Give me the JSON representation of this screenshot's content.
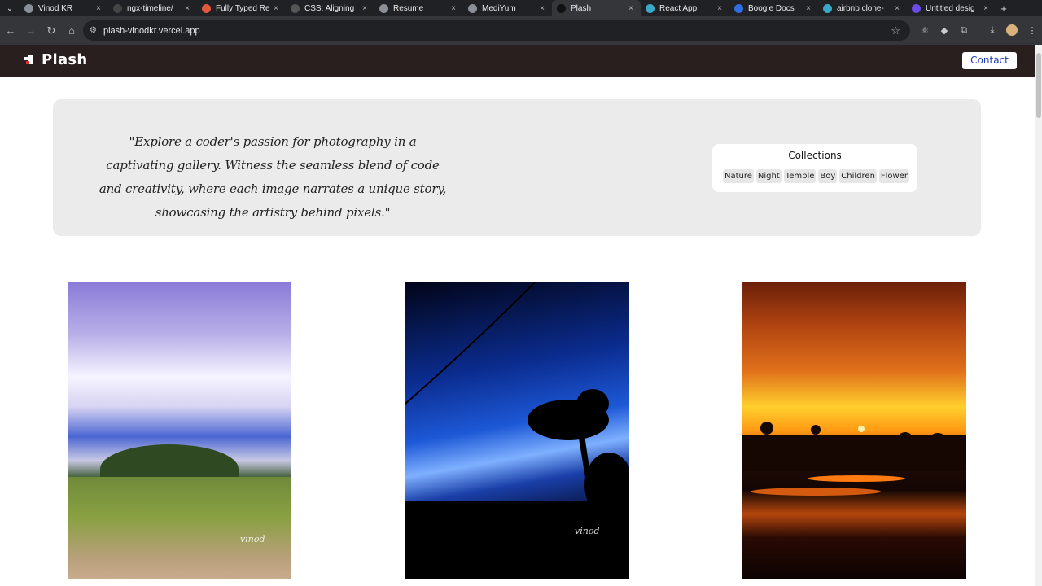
{
  "browser": {
    "tabs": [
      {
        "label": "Vinod KR",
        "icon": "globe-icon",
        "active": false
      },
      {
        "label": "ngx-timeline/",
        "icon": "github-icon",
        "active": false
      },
      {
        "label": "Fully Typed Re",
        "icon": "sparkle-icon",
        "active": false
      },
      {
        "label": "CSS: Aligning",
        "icon": "mdn-icon",
        "active": false
      },
      {
        "label": "Resume",
        "icon": "globe-icon",
        "active": false
      },
      {
        "label": "MediYum",
        "icon": "globe-icon",
        "active": false
      },
      {
        "label": "Plash",
        "icon": "plash-icon",
        "active": true
      },
      {
        "label": "React App",
        "icon": "react-icon",
        "active": false
      },
      {
        "label": "Boogle Docs",
        "icon": "docs-icon",
        "active": false
      },
      {
        "label": "airbnb clone-",
        "icon": "react-icon",
        "active": false
      },
      {
        "label": "Untitled desig",
        "icon": "canva-icon",
        "active": false
      }
    ],
    "url": "plash-vinodkr.vercel.app"
  },
  "site": {
    "logo_text": "Plash",
    "contact_label": "Contact"
  },
  "hero": {
    "quote": "\"Explore a coder's passion for photography in a captivating gallery. Witness the seamless blend of code and creativity, where each image narrates a unique story, showcasing the artistry behind pixels.\"",
    "collections_title": "Collections",
    "collections": [
      "Nature",
      "Night",
      "Temple",
      "Boy",
      "Children",
      "Flower"
    ]
  },
  "gallery": {
    "photos": [
      {
        "subject": "cloudy sky over green hill"
      },
      {
        "subject": "blue night sky with palm silhouette"
      },
      {
        "subject": "orange sunset over water"
      }
    ]
  }
}
